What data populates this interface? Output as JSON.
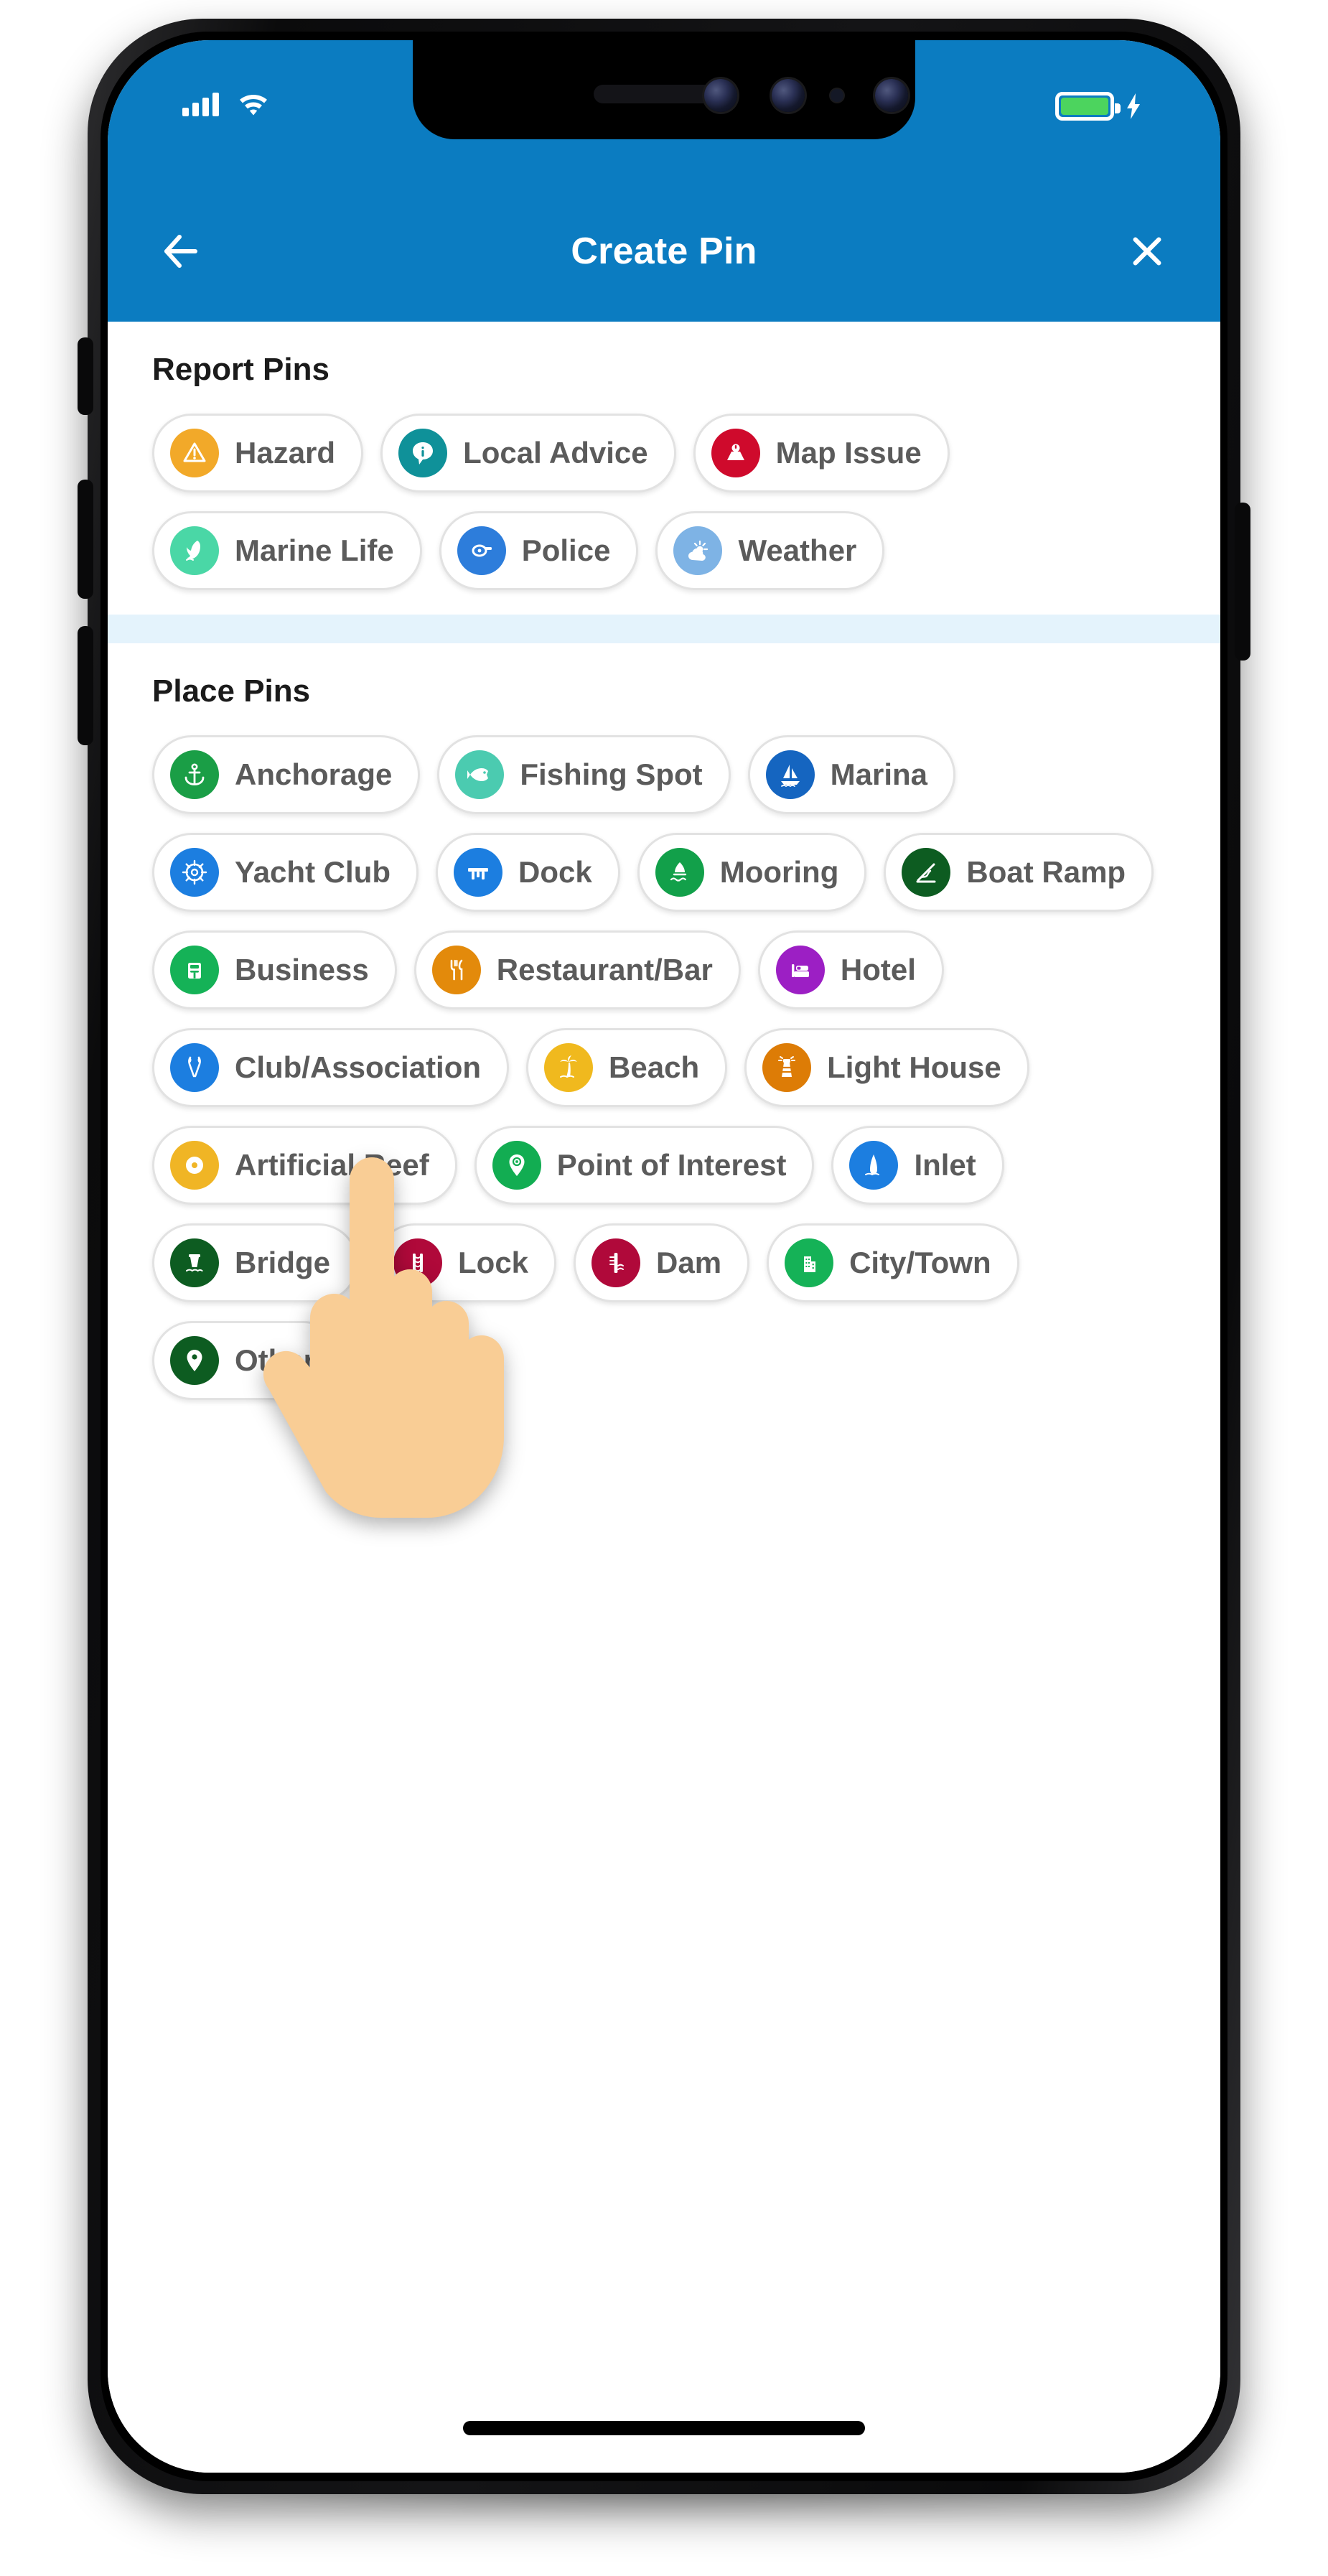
{
  "status_bar": {
    "signal_icon": "cellular-signal-icon",
    "wifi_icon": "wifi-icon",
    "battery_icon": "battery-full-icon",
    "charging_icon": "charging-bolt-icon",
    "battery_level_percent": 100
  },
  "app_bar": {
    "back_icon": "arrow-left-icon",
    "title": "Create Pin",
    "close_icon": "close-x-icon"
  },
  "sections": [
    {
      "id": "report-pins",
      "title": "Report Pins",
      "items": [
        {
          "label": "Hazard",
          "icon": "warning-triangle-icon",
          "color": "#f2a929"
        },
        {
          "label": "Local Advice",
          "icon": "info-bubble-icon",
          "color": "#0f9199"
        },
        {
          "label": "Map Issue",
          "icon": "map-issue-icon",
          "color": "#cf0a2c"
        },
        {
          "label": "Marine Life",
          "icon": "dolphin-icon",
          "color": "#4ad7a6"
        },
        {
          "label": "Police",
          "icon": "police-siren-icon",
          "color": "#2d7ddb"
        },
        {
          "label": "Weather",
          "icon": "weather-cloud-icon",
          "color": "#7eb3e5"
        }
      ]
    },
    {
      "id": "place-pins",
      "title": "Place Pins",
      "items": [
        {
          "label": "Anchorage",
          "icon": "anchor-icon",
          "color": "#1a9e46"
        },
        {
          "label": "Fishing Spot",
          "icon": "fish-icon",
          "color": "#4bcbb0"
        },
        {
          "label": "Marina",
          "icon": "sailboat-icon",
          "color": "#1565c0"
        },
        {
          "label": "Yacht Club",
          "icon": "ship-wheel-icon",
          "color": "#1c7ee0"
        },
        {
          "label": "Dock",
          "icon": "dock-icon",
          "color": "#1c7ee0"
        },
        {
          "label": "Mooring",
          "icon": "mooring-buoy-icon",
          "color": "#12a04a"
        },
        {
          "label": "Boat Ramp",
          "icon": "boat-ramp-icon",
          "color": "#0d5c21"
        },
        {
          "label": "Business",
          "icon": "briefcase-icon",
          "color": "#15b257"
        },
        {
          "label": "Restaurant/Bar",
          "icon": "fork-knife-icon",
          "color": "#e38a0b"
        },
        {
          "label": "Hotel",
          "icon": "bed-icon",
          "color": "#9c1fc4"
        },
        {
          "label": "Club/Association",
          "icon": "crossed-oars-icon",
          "color": "#1c7ee0"
        },
        {
          "label": "Beach",
          "icon": "palm-tree-icon",
          "color": "#f0b91e"
        },
        {
          "label": "Light House",
          "icon": "lighthouse-icon",
          "color": "#dd7c06"
        },
        {
          "label": "Artificial Reef",
          "icon": "reef-ring-icon",
          "color": "#f0b525"
        },
        {
          "label": "Point of Interest",
          "icon": "map-pin-star-icon",
          "color": "#12ad52"
        },
        {
          "label": "Inlet",
          "icon": "inlet-icon",
          "color": "#1c7ee0"
        },
        {
          "label": "Bridge",
          "icon": "bridge-icon",
          "color": "#0d5c21"
        },
        {
          "label": "Lock",
          "icon": "lock-gate-icon",
          "color": "#b0093a"
        },
        {
          "label": "Dam",
          "icon": "dam-icon",
          "color": "#b0093a"
        },
        {
          "label": "City/Town",
          "icon": "city-buildings-icon",
          "color": "#15b257"
        },
        {
          "label": "Other",
          "icon": "map-pin-icon",
          "color": "#0d5c21"
        }
      ]
    }
  ],
  "cursor": {
    "icon": "pointing-hand-cursor"
  },
  "home_indicator": "home-indicator-bar",
  "theme": {
    "brand_blue": "#0b7cc1",
    "divider_blue": "#e4f3fc",
    "chip_border": "#e2e2e2",
    "label_gray": "#5b5b5b"
  }
}
